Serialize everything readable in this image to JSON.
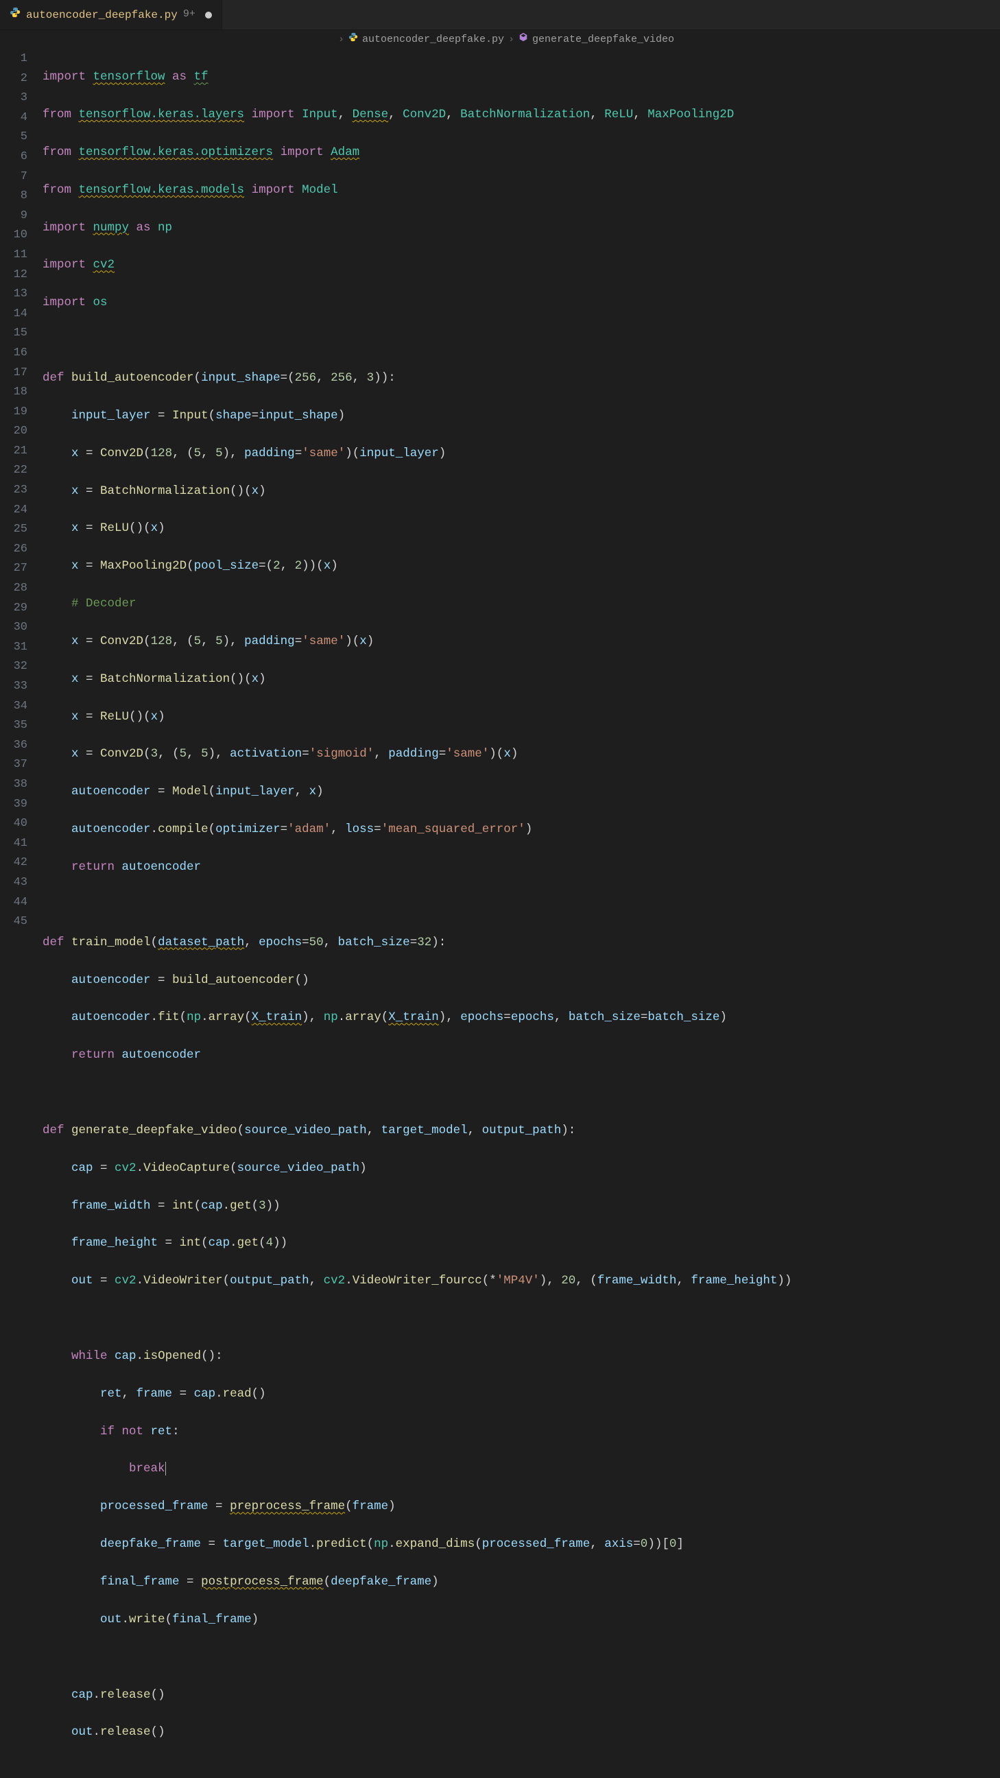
{
  "tab": {
    "icon": "python-icon",
    "filename": "autoencoder_deepfake.py",
    "badge": "9+",
    "dirty": true
  },
  "breadcrumb": {
    "sep1": "›",
    "file_icon": "python-icon",
    "file": "autoencoder_deepfake.py",
    "sep2": "›",
    "symbol_icon": "symbol-method-icon",
    "symbol": "generate_deepfake_video"
  },
  "code": {
    "line_count": 45,
    "lines": {
      "l1": {
        "a": "import ",
        "b": "tensorflow",
        "c": " as ",
        "d": "tf"
      },
      "l2": {
        "a": "from ",
        "b": "tensorflow.keras.layers",
        "c": " import ",
        "d": "Input",
        "e": ", ",
        "f": "Dense",
        "g": ", ",
        "h": "Conv2D",
        "i": ", ",
        "j": "BatchNormalization",
        "k": ", ",
        "l": "ReLU",
        "m": ", ",
        "n": "MaxPooling2D"
      },
      "l3": {
        "a": "from ",
        "b": "tensorflow.keras.optimizers",
        "c": " import ",
        "d": "Adam"
      },
      "l4": {
        "a": "from ",
        "b": "tensorflow.keras.models",
        "c": " import ",
        "d": "Model"
      },
      "l5": {
        "a": "import ",
        "b": "numpy",
        "c": " as ",
        "d": "np"
      },
      "l6": {
        "a": "import ",
        "b": "cv2"
      },
      "l7": {
        "a": "import ",
        "b": "os"
      },
      "l9": {
        "a": "def ",
        "b": "build_autoencoder",
        "c": "(",
        "d": "input_shape",
        "e": "=(",
        "f": "256",
        "g": ", ",
        "h": "256",
        "i": ", ",
        "j": "3",
        "k": ")):"
      },
      "l10": {
        "a": "    ",
        "b": "input_layer",
        "c": " = ",
        "d": "Input",
        "e": "(",
        "f": "shape",
        "g": "=",
        "h": "input_shape",
        "i": ")"
      },
      "l11": {
        "a": "    ",
        "b": "x",
        "c": " = ",
        "d": "Conv2D",
        "e": "(",
        "f": "128",
        "g": ", (",
        "h": "5",
        "i": ", ",
        "j": "5",
        "k": "), ",
        "l": "padding",
        "m": "=",
        "n": "'same'",
        "o": ")(",
        "p": "input_layer",
        "q": ")"
      },
      "l12": {
        "a": "    ",
        "b": "x",
        "c": " = ",
        "d": "BatchNormalization",
        "e": "()(",
        "f": "x",
        "g": ")"
      },
      "l13": {
        "a": "    ",
        "b": "x",
        "c": " = ",
        "d": "ReLU",
        "e": "()(",
        "f": "x",
        "g": ")"
      },
      "l14": {
        "a": "    ",
        "b": "x",
        "c": " = ",
        "d": "MaxPooling2D",
        "e": "(",
        "f": "pool_size",
        "g": "=(",
        "h": "2",
        "i": ", ",
        "j": "2",
        "k": "))(",
        "l": "x",
        "m": ")"
      },
      "l15": {
        "a": "    ",
        "b": "# Decoder"
      },
      "l16": {
        "a": "    ",
        "b": "x",
        "c": " = ",
        "d": "Conv2D",
        "e": "(",
        "f": "128",
        "g": ", (",
        "h": "5",
        "i": ", ",
        "j": "5",
        "k": "), ",
        "l": "padding",
        "m": "=",
        "n": "'same'",
        "o": ")(",
        "p": "x",
        "q": ")"
      },
      "l17": {
        "a": "    ",
        "b": "x",
        "c": " = ",
        "d": "BatchNormalization",
        "e": "()(",
        "f": "x",
        "g": ")"
      },
      "l18": {
        "a": "    ",
        "b": "x",
        "c": " = ",
        "d": "ReLU",
        "e": "()(",
        "f": "x",
        "g": ")"
      },
      "l19": {
        "a": "    ",
        "b": "x",
        "c": " = ",
        "d": "Conv2D",
        "e": "(",
        "f": "3",
        "g": ", (",
        "h": "5",
        "i": ", ",
        "j": "5",
        "k": "), ",
        "l": "activation",
        "m": "=",
        "n": "'sigmoid'",
        "o": ", ",
        "p": "padding",
        "q": "=",
        "r": "'same'",
        "s": ")(",
        "t": "x",
        "u": ")"
      },
      "l20": {
        "a": "    ",
        "b": "autoencoder",
        "c": " = ",
        "d": "Model",
        "e": "(",
        "f": "input_layer",
        "g": ", ",
        "h": "x",
        "i": ")"
      },
      "l21": {
        "a": "    ",
        "b": "autoencoder",
        "c": ".",
        "d": "compile",
        "e": "(",
        "f": "optimizer",
        "g": "=",
        "h": "'adam'",
        "i": ", ",
        "j": "loss",
        "k": "=",
        "l": "'mean_squared_error'",
        "m": ")"
      },
      "l22": {
        "a": "    ",
        "b": "return ",
        "c": "autoencoder"
      },
      "l24": {
        "a": "def ",
        "b": "train_model",
        "c": "(",
        "d": "dataset_path",
        "e": ", ",
        "f": "epochs",
        "g": "=",
        "h": "50",
        "i": ", ",
        "j": "batch_size",
        "k": "=",
        "l": "32",
        "m": "):"
      },
      "l25": {
        "a": "    ",
        "b": "autoencoder",
        "c": " = ",
        "d": "build_autoencoder",
        "e": "()"
      },
      "l26": {
        "a": "    ",
        "b": "autoencoder",
        "c": ".",
        "d": "fit",
        "e": "(",
        "f": "np",
        "g": ".",
        "h": "array",
        "i": "(",
        "j": "X_train",
        "k": "), ",
        "l": "np",
        "m": ".",
        "n": "array",
        "o": "(",
        "p": "X_train",
        "q": "), ",
        "r": "epochs",
        "s": "=",
        "t": "epochs",
        "u": ", ",
        "v": "batch_size",
        "w": "=",
        "x": "batch_size",
        "y": ")"
      },
      "l27": {
        "a": "    ",
        "b": "return ",
        "c": "autoencoder"
      },
      "l29": {
        "a": "def ",
        "b": "generate_deepfake_video",
        "c": "(",
        "d": "source_video_path",
        "e": ", ",
        "f": "target_model",
        "g": ", ",
        "h": "output_path",
        "i": "):"
      },
      "l30": {
        "a": "    ",
        "b": "cap",
        "c": " = ",
        "d": "cv2",
        "e": ".",
        "f": "VideoCapture",
        "g": "(",
        "h": "source_video_path",
        "i": ")"
      },
      "l31": {
        "a": "    ",
        "b": "frame_width",
        "c": " = ",
        "d": "int",
        "e": "(",
        "f": "cap",
        "g": ".",
        "h": "get",
        "i": "(",
        "j": "3",
        "k": "))"
      },
      "l32": {
        "a": "    ",
        "b": "frame_height",
        "c": " = ",
        "d": "int",
        "e": "(",
        "f": "cap",
        "g": ".",
        "h": "get",
        "i": "(",
        "j": "4",
        "k": "))"
      },
      "l33": {
        "a": "    ",
        "b": "out",
        "c": " = ",
        "d": "cv2",
        "e": ".",
        "f": "VideoWriter",
        "g": "(",
        "h": "output_path",
        "i": ", ",
        "j": "cv2",
        "k": ".",
        "l": "VideoWriter_fourcc",
        "m": "(*",
        "n": "'MP4V'",
        "o": "), ",
        "p": "20",
        "q": ", (",
        "r": "frame_width",
        "s": ", ",
        "t": "frame_height",
        "u": "))"
      },
      "l35": {
        "a": "    ",
        "b": "while ",
        "c": "cap",
        "d": ".",
        "e": "isOpened",
        "f": "():"
      },
      "l36": {
        "a": "        ",
        "b": "ret",
        "c": ", ",
        "d": "frame",
        "e": " = ",
        "f": "cap",
        "g": ".",
        "h": "read",
        "i": "()"
      },
      "l37": {
        "a": "        ",
        "b": "if ",
        "c": "not ",
        "d": "ret",
        "e": ":"
      },
      "l38": {
        "a": "            ",
        "b": "break"
      },
      "l39": {
        "a": "        ",
        "b": "processed_frame",
        "c": " = ",
        "d": "preprocess_frame",
        "e": "(",
        "f": "frame",
        "g": ")"
      },
      "l40": {
        "a": "        ",
        "b": "deepfake_frame",
        "c": " = ",
        "d": "target_model",
        "e": ".",
        "f": "predict",
        "g": "(",
        "h": "np",
        "i": ".",
        "j": "expand_dims",
        "k": "(",
        "l": "processed_frame",
        "m": ", ",
        "n": "axis",
        "o": "=",
        "p": "0",
        "q": "))[",
        "r": "0",
        "s": "]"
      },
      "l41": {
        "a": "        ",
        "b": "final_frame",
        "c": " = ",
        "d": "postprocess_frame",
        "e": "(",
        "f": "deepfake_frame",
        "g": ")"
      },
      "l42": {
        "a": "        ",
        "b": "out",
        "c": ".",
        "d": "write",
        "e": "(",
        "f": "final_frame",
        "g": ")"
      },
      "l44": {
        "a": "    ",
        "b": "cap",
        "c": ".",
        "d": "release",
        "e": "()"
      },
      "l45": {
        "a": "    ",
        "b": "out",
        "c": ".",
        "d": "release",
        "e": "()"
      }
    }
  }
}
